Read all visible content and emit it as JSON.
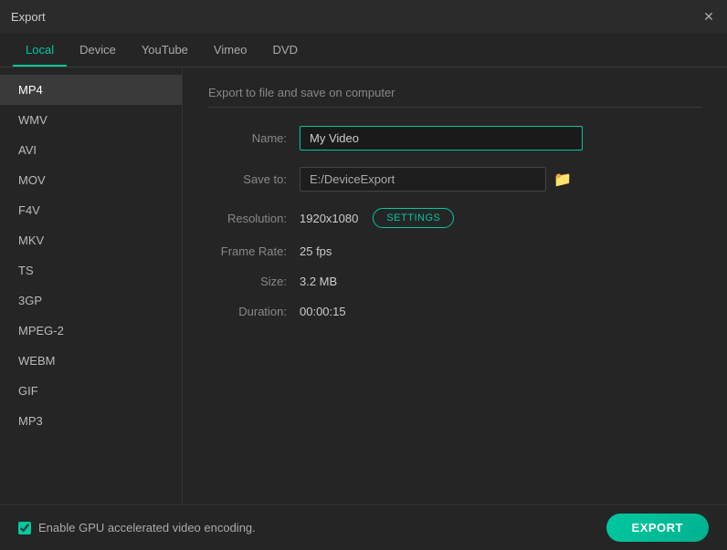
{
  "window": {
    "title": "Export"
  },
  "tabs": [
    {
      "id": "local",
      "label": "Local",
      "active": true
    },
    {
      "id": "device",
      "label": "Device",
      "active": false
    },
    {
      "id": "youtube",
      "label": "YouTube",
      "active": false
    },
    {
      "id": "vimeo",
      "label": "Vimeo",
      "active": false
    },
    {
      "id": "dvd",
      "label": "DVD",
      "active": false
    }
  ],
  "sidebar": {
    "items": [
      {
        "id": "mp4",
        "label": "MP4",
        "active": true
      },
      {
        "id": "wmv",
        "label": "WMV",
        "active": false
      },
      {
        "id": "avi",
        "label": "AVI",
        "active": false
      },
      {
        "id": "mov",
        "label": "MOV",
        "active": false
      },
      {
        "id": "f4v",
        "label": "F4V",
        "active": false
      },
      {
        "id": "mkv",
        "label": "MKV",
        "active": false
      },
      {
        "id": "ts",
        "label": "TS",
        "active": false
      },
      {
        "id": "3gp",
        "label": "3GP",
        "active": false
      },
      {
        "id": "mpeg2",
        "label": "MPEG-2",
        "active": false
      },
      {
        "id": "webm",
        "label": "WEBM",
        "active": false
      },
      {
        "id": "gif",
        "label": "GIF",
        "active": false
      },
      {
        "id": "mp3",
        "label": "MP3",
        "active": false
      }
    ]
  },
  "main": {
    "section_title": "Export to file and save on computer",
    "fields": {
      "name_label": "Name:",
      "name_value": "My Video",
      "save_to_label": "Save to:",
      "save_to_value": "E:/DeviceExport",
      "resolution_label": "Resolution:",
      "resolution_value": "1920x1080",
      "frame_rate_label": "Frame Rate:",
      "frame_rate_value": "25 fps",
      "size_label": "Size:",
      "size_value": "3.2 MB",
      "duration_label": "Duration:",
      "duration_value": "00:00:15"
    },
    "settings_btn_label": "SETTINGS"
  },
  "footer": {
    "gpu_label": "Enable GPU accelerated video encoding.",
    "export_btn_label": "EXPORT"
  },
  "icons": {
    "close": "✕",
    "folder": "🗁"
  }
}
